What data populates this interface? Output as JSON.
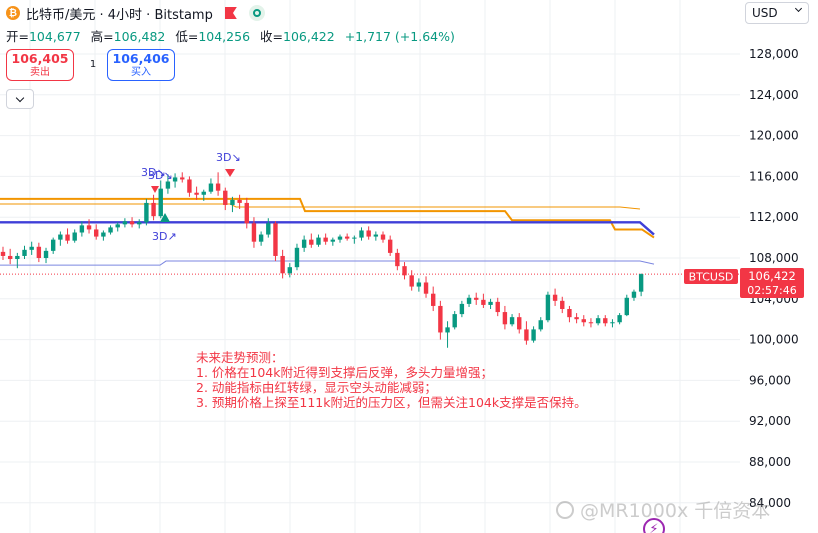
{
  "header": {
    "coin_symbol": "₿",
    "title": "比特币/美元 · 4小时 · Bitstamp",
    "flag_color": "#f23645",
    "eye_icon": "eye-icon"
  },
  "ohlc": {
    "open_label": "开=",
    "open": "104,677",
    "high_label": "高=",
    "high": "106,482",
    "low_label": "低=",
    "low": "104,256",
    "close_label": "收=",
    "close": "106,422",
    "change": "+1,717 (+1.64%)"
  },
  "trade": {
    "sell_price": "106,405",
    "sell_label": "卖出",
    "spread": "1",
    "buy_price": "106,406",
    "buy_label": "买入"
  },
  "currency_select": {
    "value": "USD"
  },
  "price_scale": {
    "ticks": [
      "128,000",
      "124,000",
      "120,000",
      "116,000",
      "112,000",
      "108,000",
      "104,000",
      "100,000",
      "96,000",
      "92,000",
      "88,000",
      "84,000"
    ],
    "symbol_tag": "BTCUSD",
    "last_price": "106,422",
    "countdown": "02:57:46"
  },
  "markers": {
    "label_a": "3D↘",
    "label_b": "3D↘",
    "label_c": "3D↗"
  },
  "annotation": {
    "title": "未来走势预测：",
    "line1": "1. 价格在104k附近得到支撑后反弹，多头力量增强；",
    "line2": "2. 动能指标由红转绿，显示空头动能减弱；",
    "line3": "3. 预期价格上探至111k附近的压力区，但需关注104k支撑是否保持。"
  },
  "watermark": {
    "text": "@MR1000x 千倍资本"
  },
  "colors": {
    "up": "#089981",
    "down": "#f23645",
    "orange": "#f29500",
    "blue": "#3f3fd8",
    "thin_blue": "#7b86e0",
    "price_line": "#f23645",
    "grid": "#eef0f3"
  },
  "chart_data": {
    "type": "candlestick",
    "y_ticks": [
      128000,
      124000,
      120000,
      116000,
      112000,
      108000,
      104000,
      100000,
      96000,
      92000,
      88000,
      84000
    ],
    "ylim": [
      83000,
      131000
    ],
    "last_price": 106422,
    "candles": [
      [
        108600,
        109100,
        107800,
        108200
      ],
      [
        108200,
        108900,
        107400,
        107900
      ],
      [
        107900,
        108500,
        107000,
        108200
      ],
      [
        108200,
        109200,
        107900,
        108800
      ],
      [
        108800,
        109600,
        108300,
        109100
      ],
      [
        109100,
        109500,
        107600,
        108000
      ],
      [
        108000,
        109000,
        107500,
        108700
      ],
      [
        108700,
        110000,
        108400,
        109800
      ],
      [
        109800,
        110600,
        109200,
        110300
      ],
      [
        110300,
        110900,
        109400,
        109700
      ],
      [
        109700,
        110800,
        109500,
        110500
      ],
      [
        110500,
        111600,
        110100,
        111200
      ],
      [
        111200,
        111800,
        110400,
        110800
      ],
      [
        110800,
        111300,
        109800,
        110100
      ],
      [
        110100,
        110700,
        109700,
        110500
      ],
      [
        110500,
        111200,
        110300,
        111000
      ],
      [
        111000,
        111500,
        110600,
        111300
      ],
      [
        111300,
        111900,
        111000,
        111600
      ],
      [
        111600,
        112000,
        111000,
        111300
      ],
      [
        111300,
        111800,
        110900,
        111500
      ],
      [
        111500,
        113800,
        111200,
        113400
      ],
      [
        113400,
        114200,
        111700,
        112100
      ],
      [
        112100,
        115600,
        111900,
        114800
      ],
      [
        114800,
        116200,
        114300,
        115500
      ],
      [
        115500,
        116300,
        114900,
        115900
      ],
      [
        115900,
        116400,
        115400,
        115700
      ],
      [
        115700,
        116000,
        114000,
        114400
      ],
      [
        114400,
        115000,
        113700,
        114200
      ],
      [
        114200,
        114700,
        113600,
        114500
      ],
      [
        114500,
        115800,
        114300,
        115300
      ],
      [
        115300,
        116400,
        114100,
        114600
      ],
      [
        114600,
        114900,
        112700,
        113200
      ],
      [
        113200,
        114000,
        112500,
        113700
      ],
      [
        113700,
        114200,
        112800,
        113400
      ],
      [
        113400,
        113900,
        110900,
        111400
      ],
      [
        111400,
        112000,
        109000,
        109600
      ],
      [
        109600,
        110600,
        109200,
        110300
      ],
      [
        110300,
        111900,
        110000,
        111400
      ],
      [
        111400,
        111600,
        107700,
        108200
      ],
      [
        108200,
        108800,
        106000,
        106500
      ],
      [
        106500,
        107500,
        106100,
        107100
      ],
      [
        107100,
        109400,
        106800,
        109000
      ],
      [
        109000,
        110200,
        108600,
        109800
      ],
      [
        109800,
        110400,
        109000,
        109300
      ],
      [
        109300,
        110300,
        109100,
        110000
      ],
      [
        110000,
        110400,
        109300,
        109600
      ],
      [
        109600,
        110000,
        109200,
        109800
      ],
      [
        109800,
        110300,
        109500,
        110100
      ],
      [
        110100,
        110400,
        109700,
        109900
      ],
      [
        109900,
        110200,
        109400,
        110000
      ],
      [
        110000,
        111000,
        109700,
        110700
      ],
      [
        110700,
        111100,
        109800,
        110100
      ],
      [
        110100,
        110600,
        109700,
        110300
      ],
      [
        110300,
        110600,
        109500,
        109800
      ],
      [
        109800,
        110200,
        108200,
        108500
      ],
      [
        108500,
        108900,
        106800,
        107200
      ],
      [
        107200,
        107600,
        105900,
        106300
      ],
      [
        106300,
        106800,
        104800,
        105200
      ],
      [
        105200,
        106000,
        104700,
        105600
      ],
      [
        105600,
        106200,
        104100,
        104500
      ],
      [
        104500,
        105200,
        102800,
        103300
      ],
      [
        103300,
        103800,
        100000,
        100700
      ],
      [
        100700,
        101800,
        99200,
        101200
      ],
      [
        101200,
        102800,
        101000,
        102500
      ],
      [
        102500,
        103800,
        102200,
        103500
      ],
      [
        103500,
        104400,
        103200,
        104100
      ],
      [
        104100,
        104600,
        103400,
        103900
      ],
      [
        103900,
        104500,
        103100,
        103400
      ],
      [
        103400,
        104000,
        103000,
        103700
      ],
      [
        103700,
        104100,
        102300,
        102700
      ],
      [
        102700,
        103300,
        101000,
        101500
      ],
      [
        101500,
        102500,
        101300,
        102200
      ],
      [
        102200,
        102600,
        100600,
        101000
      ],
      [
        101000,
        101800,
        99500,
        99900
      ],
      [
        99900,
        101300,
        99700,
        101000
      ],
      [
        101000,
        102200,
        100800,
        101900
      ],
      [
        101900,
        104700,
        101700,
        104400
      ],
      [
        104400,
        105000,
        103300,
        103800
      ],
      [
        103800,
        104200,
        102600,
        103000
      ],
      [
        103000,
        103300,
        101700,
        102200
      ],
      [
        102200,
        102600,
        101600,
        102000
      ],
      [
        102000,
        102400,
        101300,
        101700
      ],
      [
        101700,
        102100,
        101200,
        101600
      ],
      [
        101600,
        102400,
        101400,
        102100
      ],
      [
        102100,
        102400,
        101300,
        101600
      ],
      [
        101600,
        102000,
        101200,
        101700
      ],
      [
        101700,
        102600,
        101500,
        102400
      ],
      [
        102400,
        104400,
        102300,
        104100
      ],
      [
        104100,
        104900,
        103800,
        104700
      ],
      [
        104700,
        106482,
        104256,
        106422
      ]
    ],
    "orange_levels": [
      [
        0,
        113800
      ],
      [
        300,
        113800
      ],
      [
        305,
        112600
      ],
      [
        505,
        112600
      ],
      [
        512,
        111700
      ],
      [
        610,
        111700
      ],
      [
        615,
        110800
      ],
      [
        642,
        110800
      ],
      [
        654,
        110000
      ]
    ],
    "blue_levels": [
      [
        0,
        111500
      ],
      [
        640,
        111500
      ],
      [
        654,
        110300
      ]
    ],
    "thin_blue_levels": [
      [
        0,
        107300
      ],
      [
        160,
        107300
      ],
      [
        166,
        107700
      ],
      [
        640,
        107700
      ],
      [
        654,
        107400
      ]
    ],
    "orange_thin_levels": [
      [
        0,
        113300
      ],
      [
        230,
        113300
      ],
      [
        236,
        113000
      ],
      [
        620,
        113000
      ],
      [
        640,
        112800
      ]
    ]
  }
}
